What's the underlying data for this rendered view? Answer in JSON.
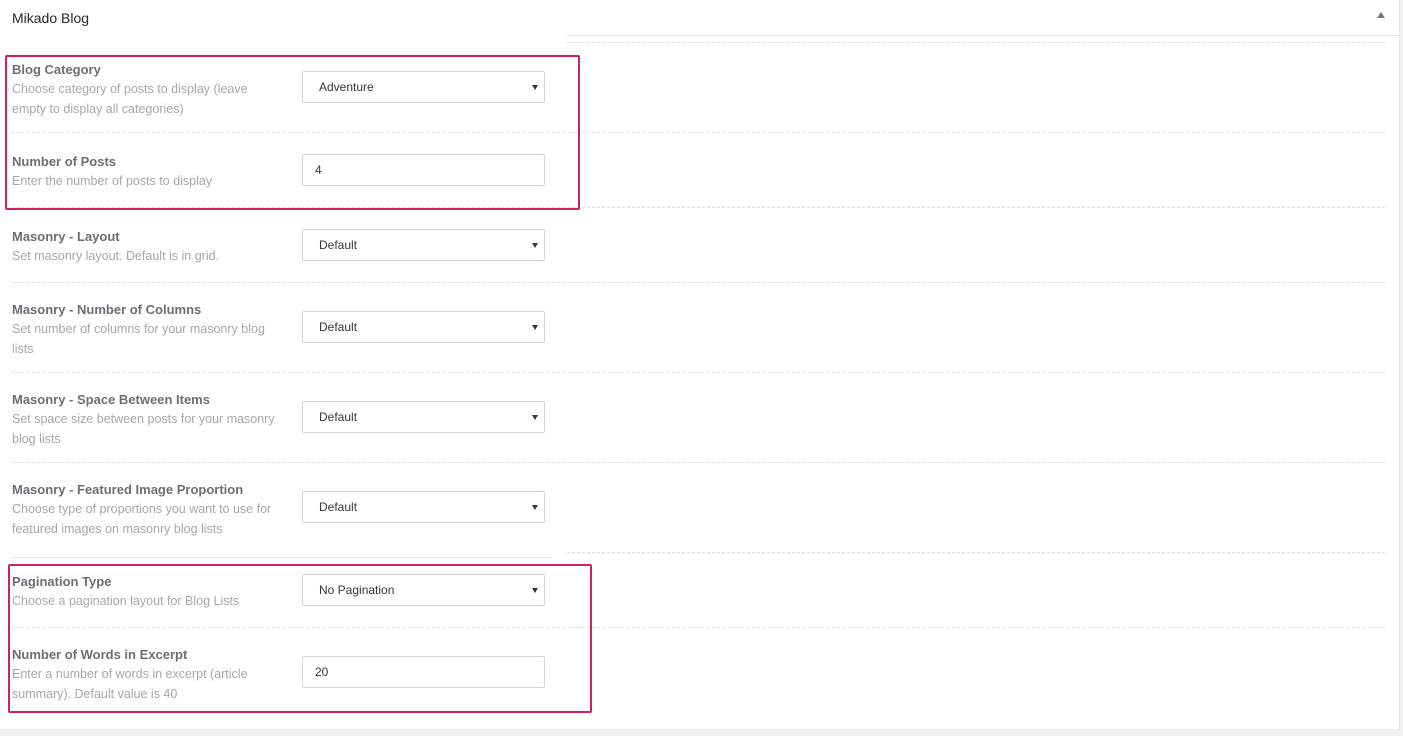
{
  "panel": {
    "title": "Mikado Blog"
  },
  "fields": [
    {
      "label": "Blog Category",
      "desc": "Choose category of posts to display (leave empty to display all categories)",
      "type": "select",
      "value": "Adventure"
    },
    {
      "label": "Number of Posts",
      "desc": "Enter the number of posts to display",
      "type": "input",
      "value": "4"
    },
    {
      "label": "Masonry - Layout",
      "desc": "Set masonry layout. Default is in grid.",
      "type": "select",
      "value": "Default"
    },
    {
      "label": "Masonry - Number of Columns",
      "desc": "Set number of columns for your masonry blog lists",
      "type": "select",
      "value": "Default"
    },
    {
      "label": "Masonry - Space Between Items",
      "desc": "Set space size between posts for your masonry blog lists",
      "type": "select",
      "value": "Default"
    },
    {
      "label": "Masonry - Featured Image Proportion",
      "desc": "Choose type of proportions you want to use for featured images on masonry blog lists",
      "type": "select",
      "value": "Default"
    },
    {
      "label": "Pagination Type",
      "desc": "Choose a pagination layout for Blog Lists",
      "type": "select",
      "value": "No Pagination"
    },
    {
      "label": "Number of Words in Excerpt",
      "desc": "Enter a number of words in excerpt (article summary). Default value is 40",
      "type": "input",
      "value": "20"
    }
  ],
  "colors": {
    "highlight": "#d0215a"
  }
}
